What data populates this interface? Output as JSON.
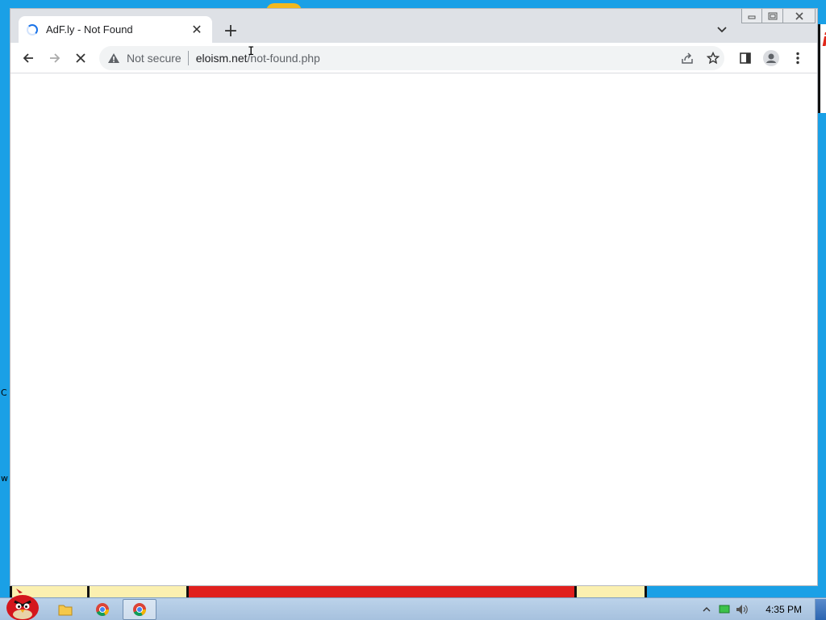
{
  "browser": {
    "tab": {
      "title": "AdF.ly - Not Found",
      "close_glyph": "✕",
      "loading": true
    },
    "new_tab_glyph": "+",
    "toolbar": {
      "security_label": "Not secure",
      "url_host": "eloism.net",
      "url_path": "/not-found.php"
    }
  },
  "taskbar": {
    "clock": "4:35 PM",
    "items": [
      "folder-icon",
      "chrome-icon",
      "chrome-icon"
    ]
  },
  "wallpaper": {
    "left_edge_chars": [
      "C",
      "w"
    ],
    "accent": "#1aa0e6"
  },
  "colors": {
    "spinner": "#1a73e8",
    "omnibox_bg": "#f1f3f4",
    "tabstrip_bg": "#dee1e6"
  }
}
